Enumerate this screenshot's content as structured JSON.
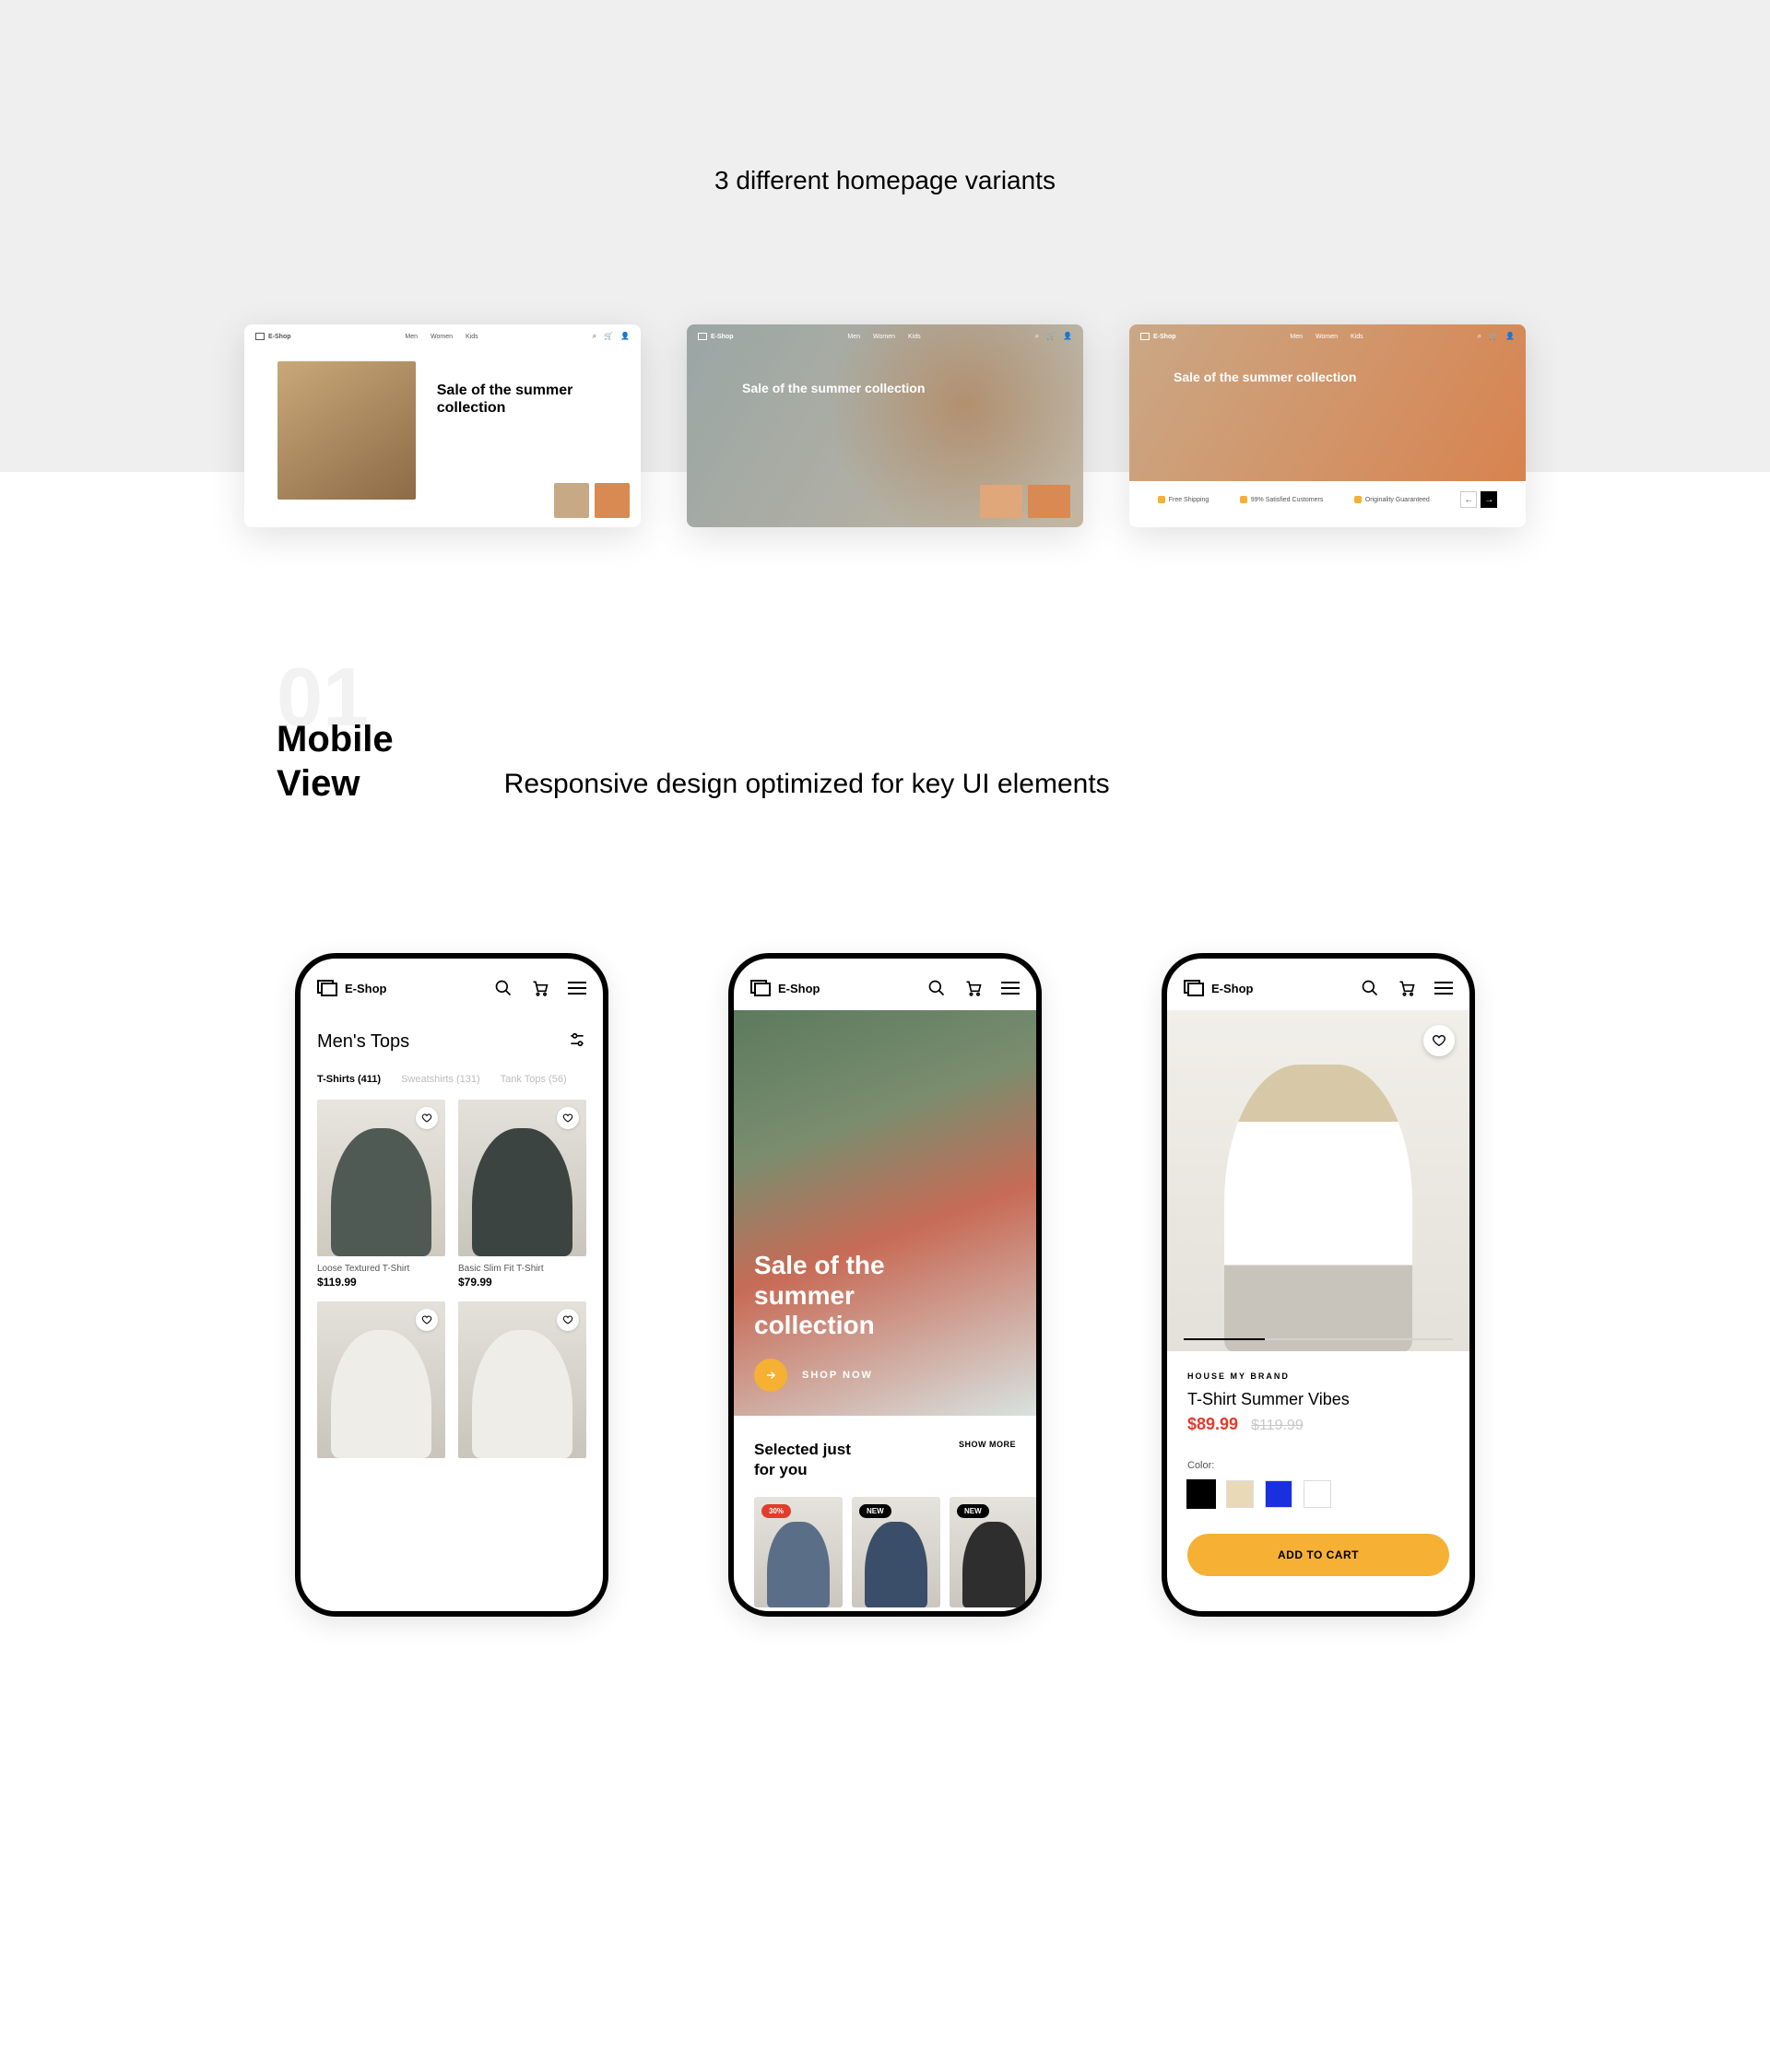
{
  "top": {
    "title": "3 different homepage variants",
    "hero_title": "Sale of the summer collection",
    "logo": "E-Shop",
    "nav": [
      "Men",
      "Women",
      "Kids"
    ],
    "v3_features": [
      "Free Shipping",
      "99% Satisfied Customers",
      "Originality Guaranteed"
    ]
  },
  "section01": {
    "num": "01",
    "left_line1": "Mobile",
    "left_line2": "View",
    "right": "Responsive design optimized for key UI elements"
  },
  "mobile": {
    "logo": "E-Shop"
  },
  "phone1": {
    "title": "Men's Tops",
    "tabs": [
      "T-Shirts (411)",
      "Sweatshirts (131)",
      "Tank Tops (56)"
    ],
    "items": [
      {
        "name": "Loose Textured T-Shirt",
        "price": "$119.99"
      },
      {
        "name": "Basic Slim Fit T-Shirt",
        "price": "$79.99"
      }
    ]
  },
  "phone2": {
    "hero_title_l1": "Sale of the",
    "hero_title_l2": "summer",
    "hero_title_l3": "collection",
    "cta": "SHOP NOW",
    "selected_l1": "Selected just",
    "selected_l2": "for you",
    "show_more": "SHOW MORE",
    "badges": [
      "30%",
      "NEW",
      "NEW"
    ]
  },
  "phone3": {
    "brand": "HOUSE MY BRAND",
    "name": "T-Shirt Summer Vibes",
    "price": "$89.99",
    "old_price": "$119.99",
    "color_label": "Color:",
    "add_to_cart": "ADD TO CART"
  }
}
